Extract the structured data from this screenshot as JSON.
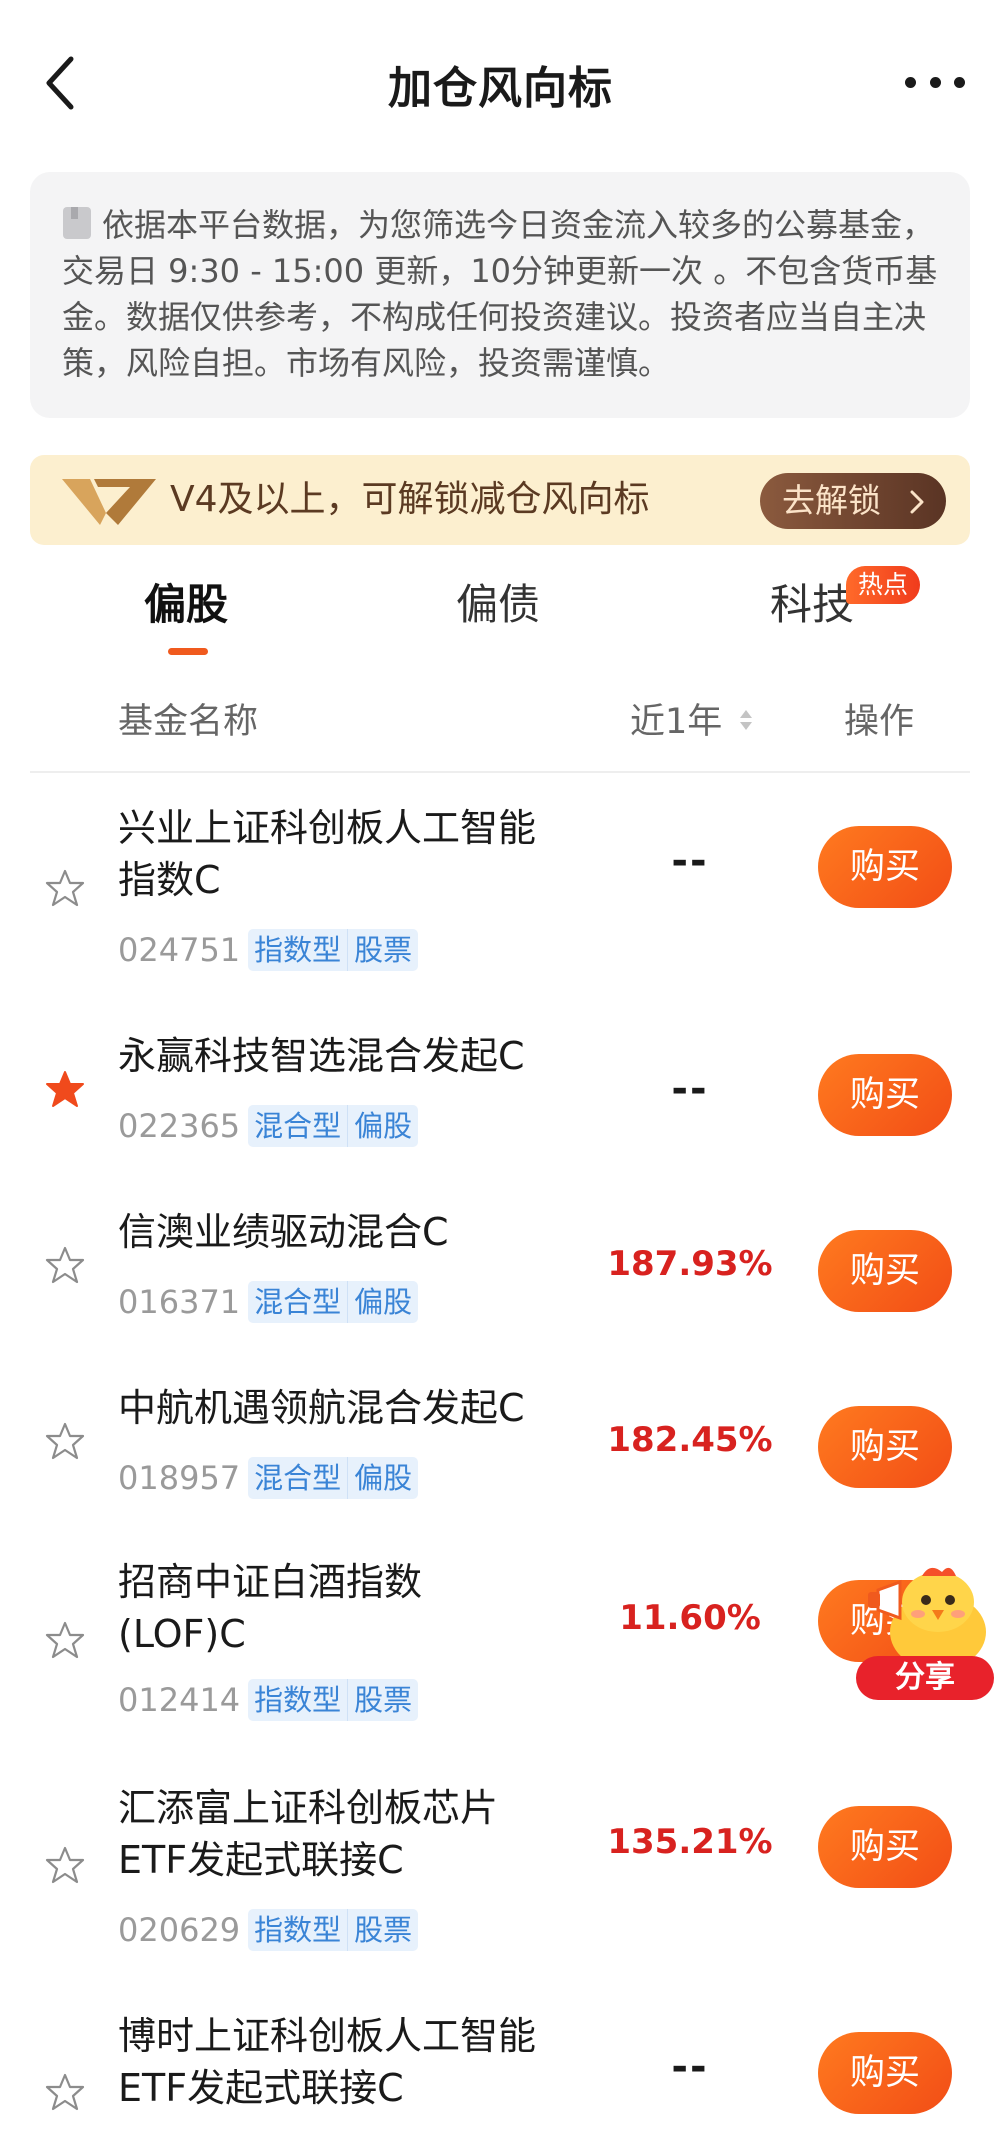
{
  "header": {
    "title": "加仓风向标"
  },
  "notice": {
    "text": "依据本平台数据，为您筛选今日资金流入较多的公募基金，交易日 9:30 - 15:00 更新，10分钟更新一次 。不包含货币基金。数据仅供参考，不构成任何投资建议。投资者应当自主决策，风险自担。市场有风险，投资需谨慎。"
  },
  "vip": {
    "text": "V4及以上，可解锁减仓风向标",
    "button_label": "去解锁"
  },
  "tabs": [
    {
      "label": "偏股",
      "active": true
    },
    {
      "label": "偏债",
      "active": false
    },
    {
      "label": "科技",
      "active": false,
      "badge": "热点"
    }
  ],
  "columns": {
    "name": "基金名称",
    "year": "近1年",
    "operation": "操作"
  },
  "funds": [
    {
      "name_line1": "兴业上证科创板人工智能",
      "name_line2": "指数C",
      "code": "024751",
      "tags": [
        "指数型",
        "股票"
      ],
      "return_1y": "--",
      "starred": false,
      "buy_label": "购买"
    },
    {
      "name_line1": "永赢科技智选混合发起C",
      "name_line2": "",
      "code": "022365",
      "tags": [
        "混合型",
        "偏股"
      ],
      "return_1y": "--",
      "starred": true,
      "buy_label": "购买"
    },
    {
      "name_line1": "信澳业绩驱动混合C",
      "name_line2": "",
      "code": "016371",
      "tags": [
        "混合型",
        "偏股"
      ],
      "return_1y": "187.93%",
      "starred": false,
      "buy_label": "购买"
    },
    {
      "name_line1": "中航机遇领航混合发起C",
      "name_line2": "",
      "code": "018957",
      "tags": [
        "混合型",
        "偏股"
      ],
      "return_1y": "182.45%",
      "starred": false,
      "buy_label": "购买"
    },
    {
      "name_line1": "招商中证白酒指数",
      "name_line2": "(LOF)C",
      "code": "012414",
      "tags": [
        "指数型",
        "股票"
      ],
      "return_1y": "11.60%",
      "starred": false,
      "buy_label": "购买"
    },
    {
      "name_line1": "汇添富上证科创板芯片",
      "name_line2": "ETF发起式联接C",
      "code": "020629",
      "tags": [
        "指数型",
        "股票"
      ],
      "return_1y": "135.21%",
      "starred": false,
      "buy_label": "购买"
    },
    {
      "name_line1": "博时上证科创板人工智能",
      "name_line2": "ETF发起式联接C",
      "code": "",
      "tags": [],
      "return_1y": "--",
      "starred": false,
      "buy_label": "购买"
    }
  ],
  "share": {
    "label": "分享"
  },
  "colors": {
    "accent": "#f05a1e",
    "positive": "#d8221f",
    "tag_text": "#3a84d6",
    "tag_bg": "#e7f1fc",
    "vip_bg": "#fcefcf",
    "star_active": "#f04a1c"
  }
}
